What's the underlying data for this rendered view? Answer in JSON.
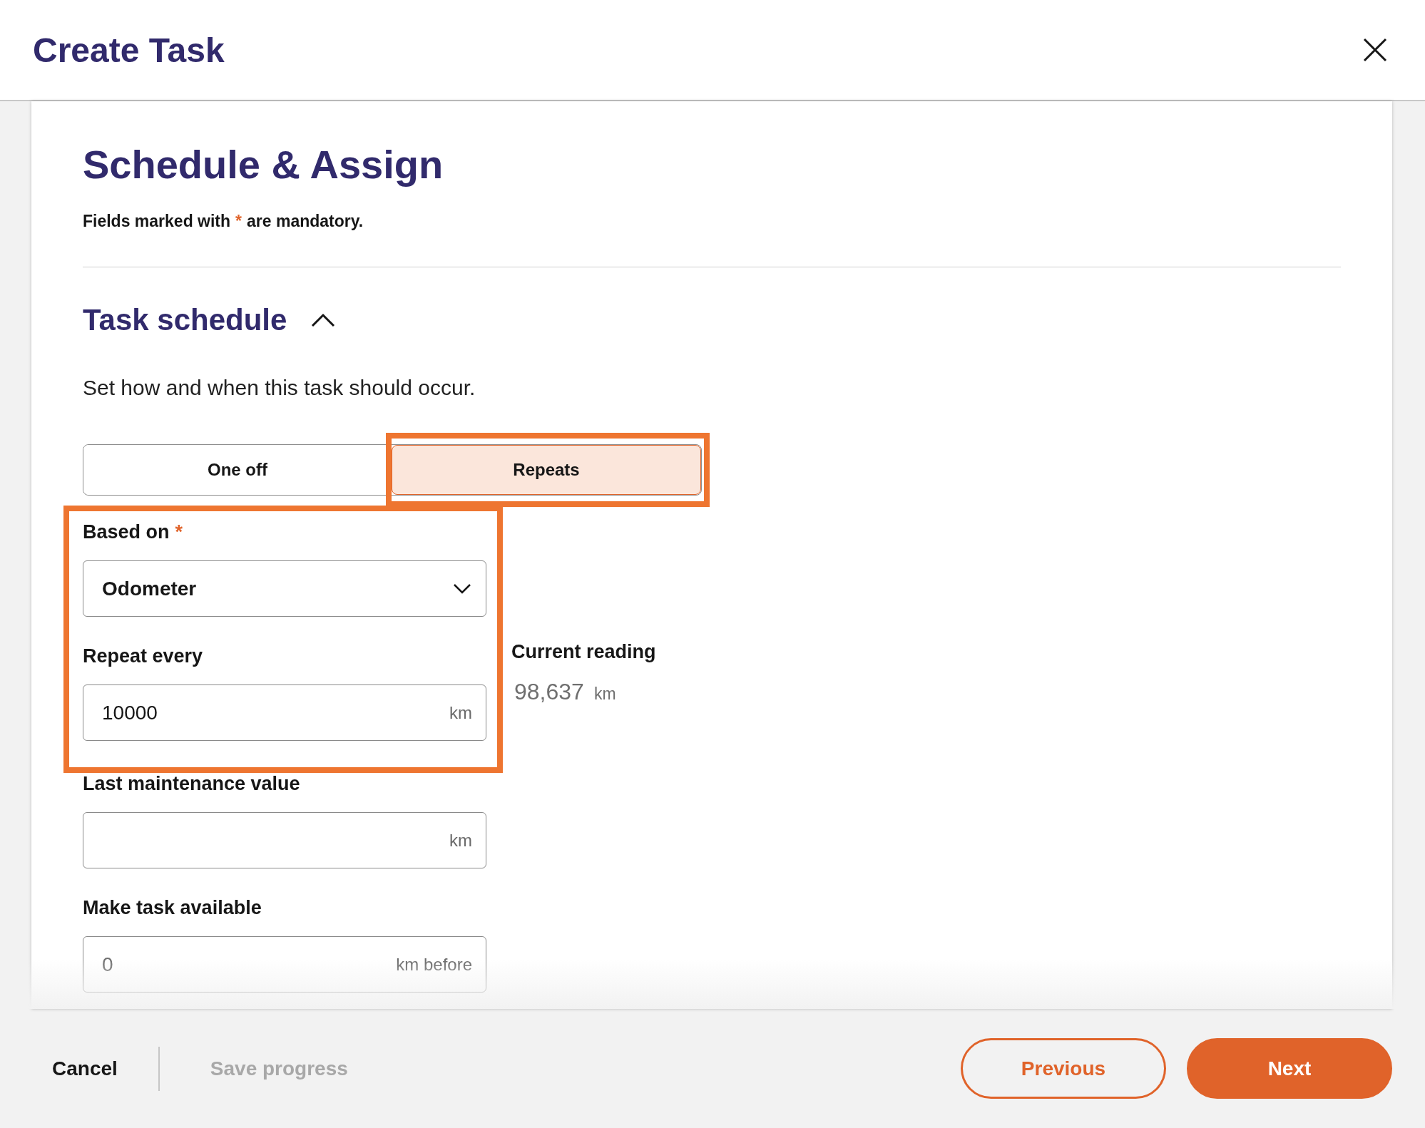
{
  "dialog": {
    "title": "Create Task"
  },
  "page": {
    "heading": "Schedule & Assign",
    "note_before": "Fields marked with",
    "required_mark": "*",
    "note_after": "are mandatory."
  },
  "section": {
    "title": "Task schedule",
    "expanded": true,
    "description": "Set how and when this task should occur."
  },
  "frequency_options": [
    {
      "label": "One off",
      "selected": false,
      "highlighted": false
    },
    {
      "label": "Repeats",
      "selected": true,
      "highlighted": true
    }
  ],
  "fields": [
    {
      "kind": "select",
      "label": "Based on",
      "required": true,
      "value": "Odometer",
      "highlighted": true
    },
    {
      "kind": "input",
      "label": "Repeat every",
      "required": false,
      "value": "10000",
      "unit": "km",
      "highlighted": true
    },
    {
      "kind": "input",
      "label": "Last maintenance value",
      "required": false,
      "unit": "km",
      "highlighted": false
    },
    {
      "kind": "input",
      "label": "Make task available",
      "required": false,
      "placeholder": "0",
      "unit": "km before",
      "highlighted": false
    }
  ],
  "current_reading": {
    "label": "Current reading",
    "value": "98,637",
    "unit": "km"
  },
  "footer": {
    "cancel": "Cancel",
    "save": {
      "label": "Save progress",
      "disabled": true
    },
    "previous": "Previous",
    "next": "Next"
  }
}
